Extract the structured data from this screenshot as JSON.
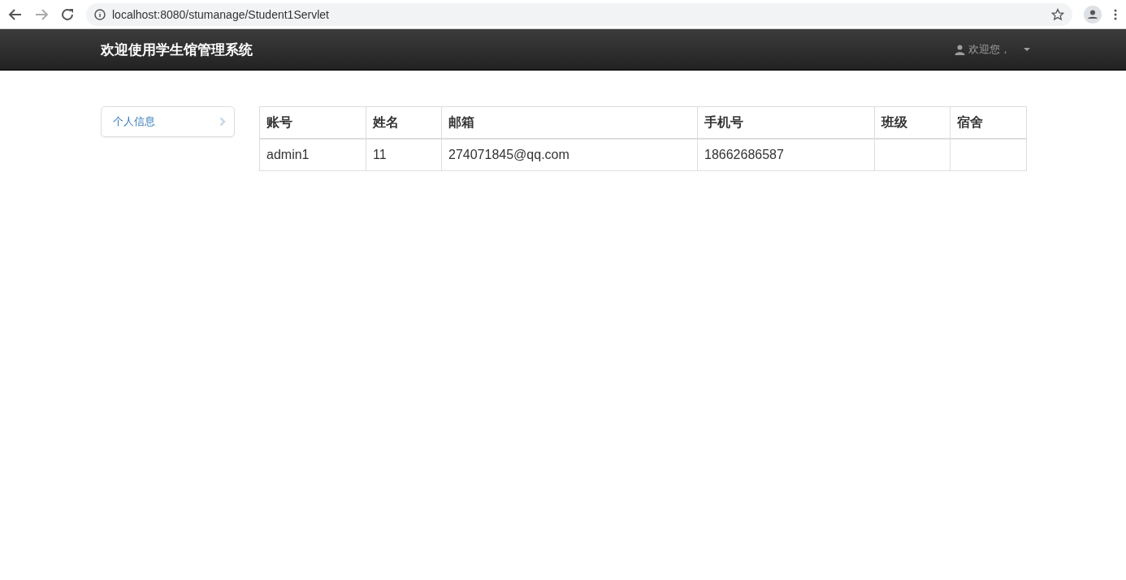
{
  "browser": {
    "url": "localhost:8080/stumanage/Student1Servlet"
  },
  "navbar": {
    "brand": "欢迎使用学生馆管理系统",
    "user_menu": "欢迎您，"
  },
  "sidebar": {
    "items": [
      {
        "label": "个人信息",
        "selected": false
      }
    ]
  },
  "table": {
    "columns": [
      "账号",
      "姓名",
      "邮箱",
      "手机号",
      "班级",
      "宿舍"
    ],
    "rows": [
      [
        "admin1",
        "11",
        "274071845@qq.com",
        "18662686587"
      ]
    ]
  }
}
